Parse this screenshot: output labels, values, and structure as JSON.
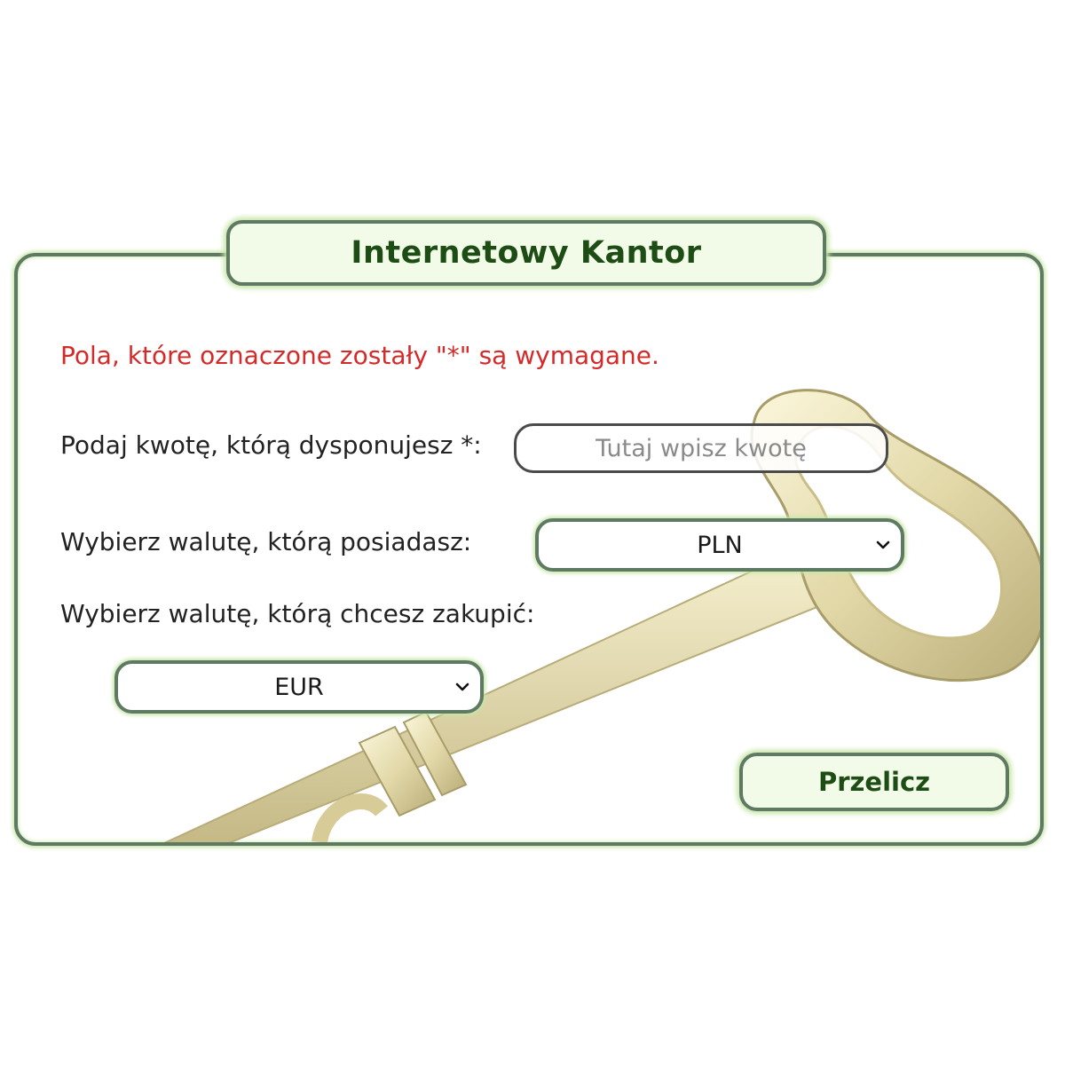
{
  "title": "Internetowy Kantor",
  "required_note": "Pola, które oznaczone zostały \"*\" są wymagane.",
  "form": {
    "amount_label": "Podaj kwotę, którą dysponujesz *:",
    "amount_placeholder": "Tutaj wpisz kwotę",
    "amount_value": "",
    "have_currency_label": "Wybierz walutę, którą posiadasz:",
    "have_currency_selected": "PLN",
    "buy_currency_label": "Wybierz walutę, którą chcesz zakupić:",
    "buy_currency_selected": "EUR",
    "submit_label": "Przelicz"
  },
  "colors": {
    "accent": "#5e7a62",
    "title_text": "#1d4d14",
    "warning_text": "#d42a2a",
    "panel_bg": "#ffffff",
    "button_bg": "#f2fbe8"
  },
  "background_image": "key-illustration"
}
